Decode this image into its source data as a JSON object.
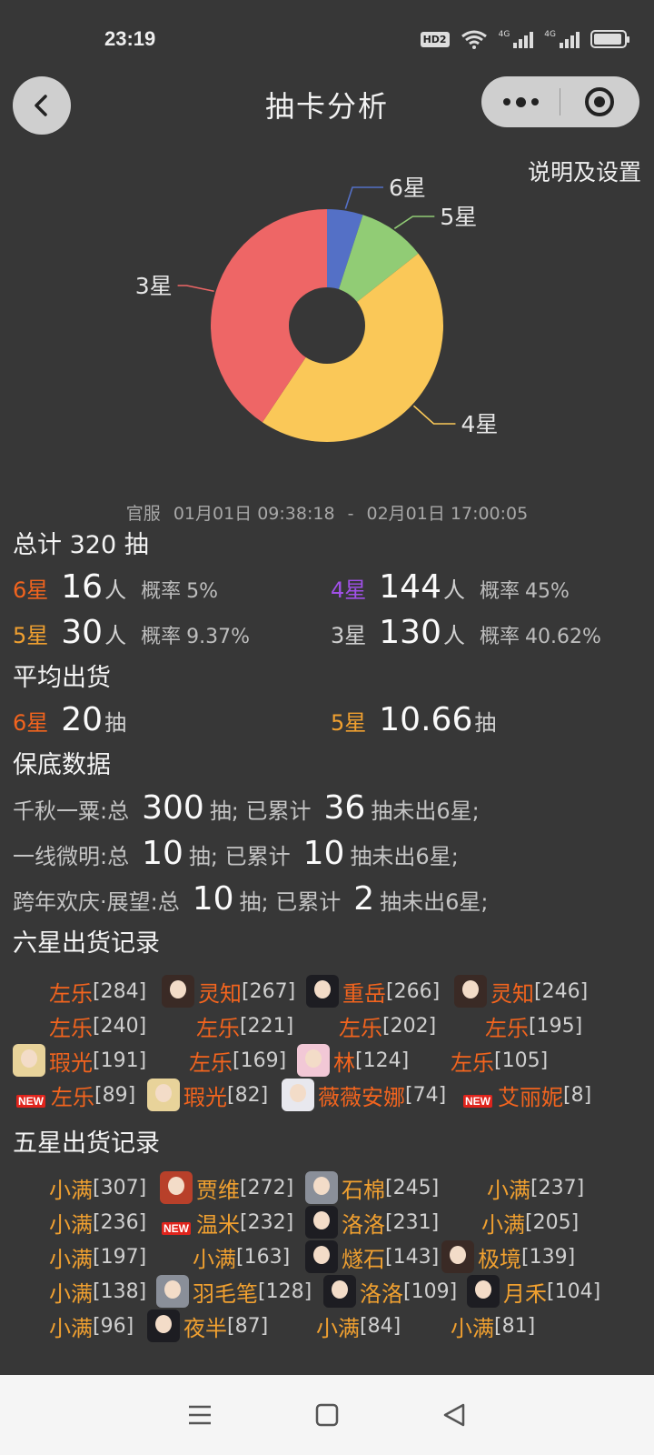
{
  "status": {
    "time": "23:19",
    "hd": "HD2",
    "net1": "4G",
    "net2": "4G"
  },
  "nav": {
    "title": "抽卡分析",
    "settings": "说明及设置"
  },
  "chart_data": {
    "type": "pie",
    "donut": true,
    "slices": [
      {
        "label": "6星",
        "value": 16,
        "color": "#5470c6"
      },
      {
        "label": "5星",
        "value": 30,
        "color": "#91cc75"
      },
      {
        "label": "4星",
        "value": 144,
        "color": "#fac858"
      },
      {
        "label": "3星",
        "value": 130,
        "color": "#ee6666"
      }
    ]
  },
  "range": {
    "server": "官服",
    "start": "01月01日 09:38:18",
    "dash": "-",
    "end": "02月01日 17:00:05"
  },
  "total": {
    "label": "总计 320 抽"
  },
  "stats": {
    "six": {
      "star": "6星",
      "count": "16",
      "unit": "人",
      "rate_label": "概率",
      "rate": "5%"
    },
    "four": {
      "star": "4星",
      "count": "144",
      "unit": "人",
      "rate_label": "概率",
      "rate": "45%"
    },
    "five": {
      "star": "5星",
      "count": "30",
      "unit": "人",
      "rate_label": "概率",
      "rate": "9.37%"
    },
    "three": {
      "star": "3星",
      "count": "130",
      "unit": "人",
      "rate_label": "概率",
      "rate": "40.62%"
    }
  },
  "average": {
    "title": "平均出货",
    "six": {
      "star": "6星",
      "value": "20",
      "unit": "抽"
    },
    "five": {
      "star": "5星",
      "value": "10.66",
      "unit": "抽"
    }
  },
  "pity": {
    "title": "保底数据",
    "rows": [
      {
        "name": "千秋一粟:总",
        "total": "300",
        "mid": "抽; 已累计",
        "acc": "36",
        "tail": "抽未出6星;"
      },
      {
        "name": "一线微明:总",
        "total": "10",
        "mid": "抽; 已累计",
        "acc": "10",
        "tail": "抽未出6星;"
      },
      {
        "name": "跨年欢庆·展望:总",
        "total": "10",
        "mid": "抽; 已累计",
        "acc": "2",
        "tail": "抽未出6星;"
      }
    ]
  },
  "six_records": {
    "title": "六星出货记录",
    "new_badge": "NEW",
    "items": [
      {
        "name": "左乐",
        "count": "[284]"
      },
      {
        "name": "灵知",
        "count": "[267]"
      },
      {
        "name": "重岳",
        "count": "[266]"
      },
      {
        "name": "灵知",
        "count": "[246]"
      },
      {
        "name": "左乐",
        "count": "[240]"
      },
      {
        "name": "左乐",
        "count": "[221]"
      },
      {
        "name": "左乐",
        "count": "[202]"
      },
      {
        "name": "左乐",
        "count": "[195]"
      },
      {
        "name": "瑕光",
        "count": "[191]"
      },
      {
        "name": "左乐",
        "count": "[169]"
      },
      {
        "name": "林",
        "count": "[124]"
      },
      {
        "name": "左乐",
        "count": "[105]"
      },
      {
        "name": "左乐",
        "count": "[89]"
      },
      {
        "name": "瑕光",
        "count": "[82]"
      },
      {
        "name": "薇薇安娜",
        "count": "[74]"
      },
      {
        "name": "艾丽妮",
        "count": "[8]"
      }
    ]
  },
  "five_records": {
    "title": "五星出货记录",
    "new_badge": "NEW",
    "items": [
      {
        "name": "小满",
        "count": "[307]"
      },
      {
        "name": "贾维",
        "count": "[272]"
      },
      {
        "name": "石棉",
        "count": "[245]"
      },
      {
        "name": "小满",
        "count": "[237]"
      },
      {
        "name": "小满",
        "count": "[236]"
      },
      {
        "name": "温米",
        "count": "[232]"
      },
      {
        "name": "洛洛",
        "count": "[231]"
      },
      {
        "name": "小满",
        "count": "[205]"
      },
      {
        "name": "小满",
        "count": "[197]"
      },
      {
        "name": "小满",
        "count": "[163]"
      },
      {
        "name": "燧石",
        "count": "[143]"
      },
      {
        "name": "极境",
        "count": "[139]"
      },
      {
        "name": "小满",
        "count": "[138]"
      },
      {
        "name": "羽毛笔",
        "count": "[128]"
      },
      {
        "name": "洛洛",
        "count": "[109]"
      },
      {
        "name": "月禾",
        "count": "[104]"
      },
      {
        "name": "小满",
        "count": "[96]"
      },
      {
        "name": "夜半",
        "count": "[87]"
      },
      {
        "name": "小满",
        "count": "[84]"
      },
      {
        "name": "小满",
        "count": "[81]"
      }
    ]
  }
}
